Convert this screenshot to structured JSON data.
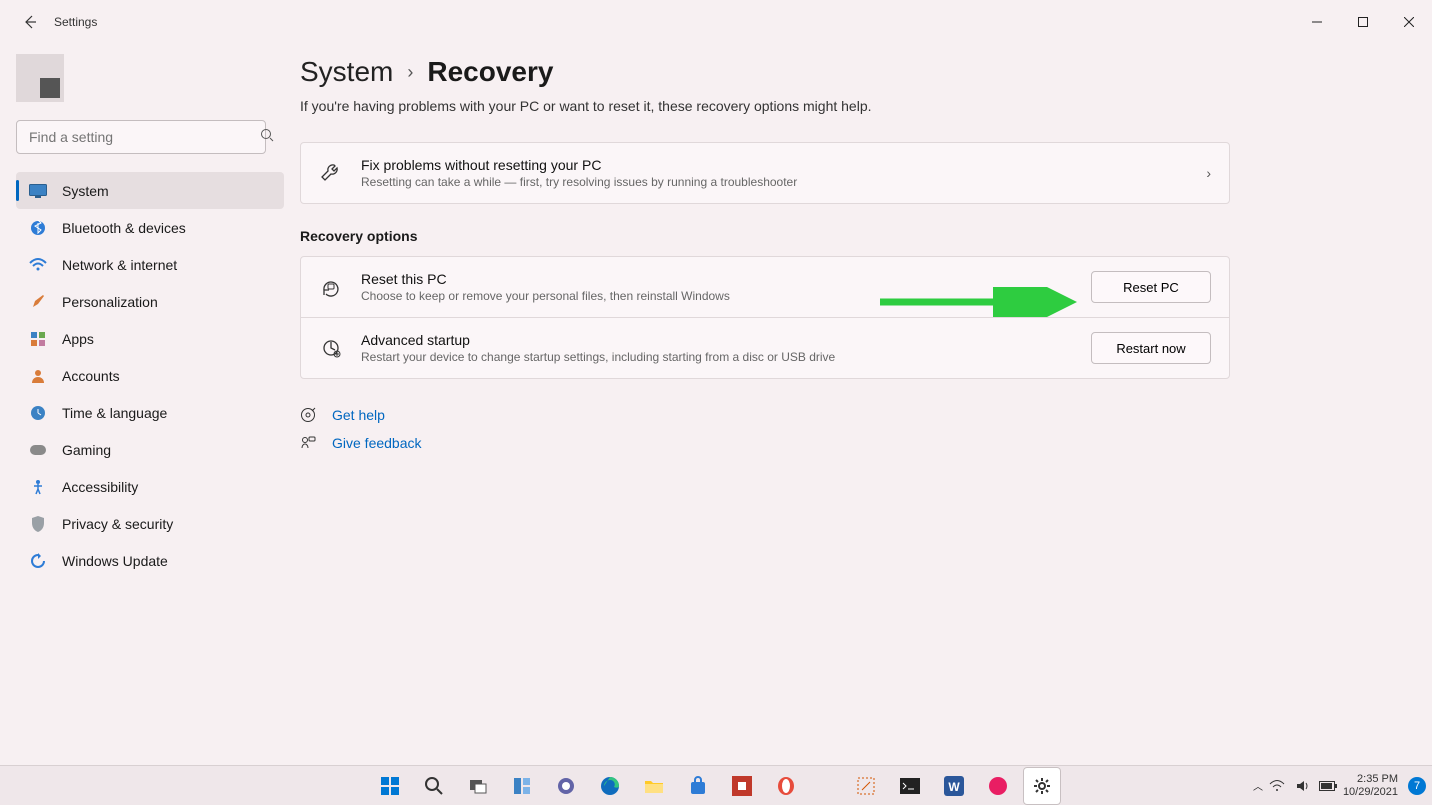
{
  "titlebar": {
    "title": "Settings"
  },
  "sidebar": {
    "search_placeholder": "Find a setting",
    "items": [
      {
        "label": "System"
      },
      {
        "label": "Bluetooth & devices"
      },
      {
        "label": "Network & internet"
      },
      {
        "label": "Personalization"
      },
      {
        "label": "Apps"
      },
      {
        "label": "Accounts"
      },
      {
        "label": "Time & language"
      },
      {
        "label": "Gaming"
      },
      {
        "label": "Accessibility"
      },
      {
        "label": "Privacy & security"
      },
      {
        "label": "Windows Update"
      }
    ]
  },
  "breadcrumb": {
    "parent": "System",
    "current": "Recovery"
  },
  "subtext": "If you're having problems with your PC or want to reset it, these recovery options might help.",
  "fix_card": {
    "title": "Fix problems without resetting your PC",
    "desc": "Resetting can take a while — first, try resolving issues by running a troubleshooter"
  },
  "section_label": "Recovery options",
  "reset_row": {
    "title": "Reset this PC",
    "desc": "Choose to keep or remove your personal files, then reinstall Windows",
    "button": "Reset PC"
  },
  "advanced_row": {
    "title": "Advanced startup",
    "desc": "Restart your device to change startup settings, including starting from a disc or USB drive",
    "button": "Restart now"
  },
  "help": {
    "get_help": "Get help",
    "feedback": "Give feedback"
  },
  "taskbar": {
    "time": "2:35 PM",
    "date": "10/29/2021",
    "badge": "7"
  }
}
